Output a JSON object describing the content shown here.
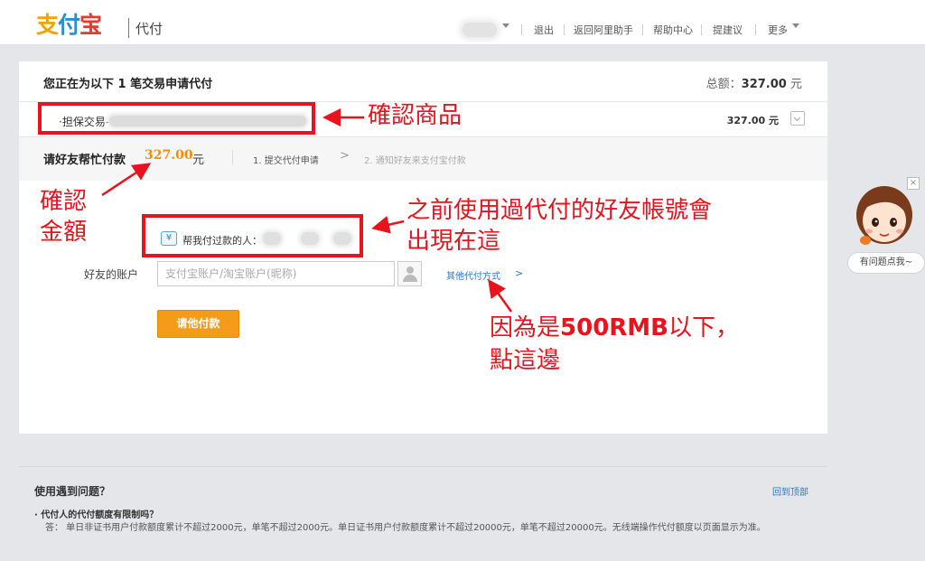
{
  "header": {
    "logo_text": [
      "支",
      "付",
      "宝"
    ],
    "product_name": "代付",
    "nav": [
      {
        "label": "退出"
      },
      {
        "label": "返回阿里助手"
      },
      {
        "label": "帮助中心"
      },
      {
        "label": "提建议"
      },
      {
        "label": "更多"
      }
    ]
  },
  "order": {
    "heading": "您正在为以下 1 笔交易申请代付",
    "total_label": "总额：",
    "total_amount": "327.00",
    "currency": "元",
    "item_label": "·担保交易--",
    "item_price": "327.00 元"
  },
  "request": {
    "title": "请好友帮忙付款",
    "amount": "327.00",
    "currency": "元",
    "step1": "1. 提交代付申请",
    "step_arrow": ">",
    "step2": "2. 通知好友来支付宝付款"
  },
  "form": {
    "helper_icon": "¥",
    "helper_label": "帮我付过款的人：",
    "account_label": "好友的账户",
    "account_placeholder": "支付宝账户/淘宝账户(昵称)",
    "account_value": "",
    "other_methods_link": "其他代付方式",
    "other_methods_arrow": ">",
    "pay_button": "请他付款"
  },
  "annotations": {
    "confirm_item": "確認商品",
    "confirm_amount": [
      "確認",
      "金額"
    ],
    "previous_payers": [
      "之前使用過代付的好友帳號會",
      "出現在這"
    ],
    "under_500_prefix": "因為是",
    "under_500_bold": "500RMB",
    "under_500_suffix": "以下，",
    "click_here": "點這邊",
    "color": "#e8131c"
  },
  "help_widget": {
    "close_label": "×",
    "bubble_text": "有问题点我~"
  },
  "footer": {
    "title": "使用遇到问题？",
    "back_to_top": "回到顶部",
    "faq_question": "· 代付人的代付额度有限制吗？",
    "faq_answer": "答：  单日非证书用户付款额度累计不超过2000元，单笔不超过2000元。单日证书用户付款额度累计不超过20000元，单笔不超过20000元。无线端操作代付额度以页面显示为准。"
  },
  "colors": {
    "brand_orange": "#f59b1a",
    "amount_orange": "#f28f00",
    "link_blue": "#2a77c8",
    "annotation_red": "#e8131c"
  }
}
